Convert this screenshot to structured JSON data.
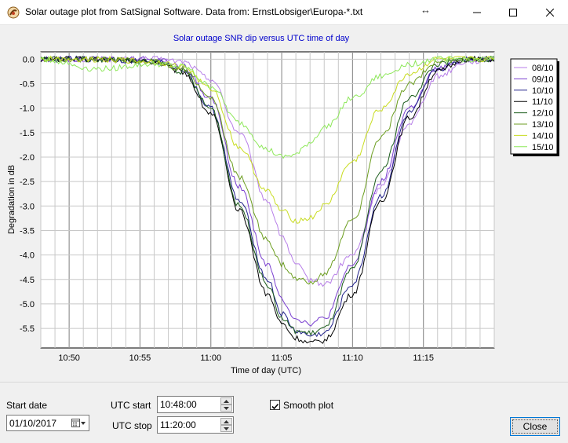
{
  "window": {
    "title": "Solar outage plot from SatSignal Software.  Data from: ErnstLobsiger\\Europa-*.txt",
    "resize_glyph": "↔"
  },
  "chart_data": {
    "type": "line",
    "title": "Solar outage SNR dip versus UTC time of day",
    "xlabel": "Time of day (UTC)",
    "ylabel": "Degradation in dB",
    "xlim": [
      "10:48:00",
      "11:20:00"
    ],
    "ylim": [
      -5.9,
      0.15
    ],
    "x_ticks": [
      "10:50",
      "10:55",
      "11:00",
      "11:05",
      "11:10",
      "11:15"
    ],
    "y_ticks": [
      "0.0",
      "-0.5",
      "-1.0",
      "-1.5",
      "-2.0",
      "-2.5",
      "-3.0",
      "-3.5",
      "-4.0",
      "-4.5",
      "-5.0",
      "-5.5"
    ],
    "grid": true,
    "legend_position": "top-right",
    "x": [
      "10:48:00",
      "10:52:00",
      "10:56:00",
      "10:58:00",
      "11:00:00",
      "11:02:00",
      "11:04:00",
      "11:05:00",
      "11:06:00",
      "11:07:00",
      "11:08:00",
      "11:10:00",
      "11:12:00",
      "11:14:00",
      "11:16:00",
      "11:18:00",
      "11:20:00"
    ],
    "series": [
      {
        "name": "08/10",
        "color": "#b77ee8",
        "values": [
          0.0,
          0.0,
          0.0,
          -0.05,
          -0.4,
          -1.5,
          -2.9,
          -3.6,
          -4.2,
          -4.5,
          -4.6,
          -4.0,
          -2.6,
          -1.3,
          -0.35,
          -0.05,
          0.0
        ]
      },
      {
        "name": "09/10",
        "color": "#7a3fd0",
        "values": [
          0.0,
          0.0,
          0.0,
          -0.15,
          -0.8,
          -2.6,
          -4.2,
          -4.9,
          -5.3,
          -5.4,
          -5.3,
          -4.2,
          -2.5,
          -1.0,
          -0.2,
          0.0,
          0.0
        ]
      },
      {
        "name": "10/10",
        "color": "#20208a",
        "values": [
          0.0,
          0.0,
          -0.05,
          -0.2,
          -1.0,
          -2.9,
          -4.5,
          -5.2,
          -5.55,
          -5.65,
          -5.6,
          -4.6,
          -2.8,
          -1.1,
          -0.2,
          0.0,
          0.0
        ]
      },
      {
        "name": "11/10",
        "color": "#000000",
        "values": [
          0.0,
          0.0,
          -0.05,
          -0.25,
          -1.1,
          -3.1,
          -4.8,
          -5.4,
          -5.7,
          -5.8,
          -5.75,
          -4.8,
          -2.9,
          -1.2,
          -0.25,
          0.0,
          0.0
        ]
      },
      {
        "name": "12/10",
        "color": "#1a5c1a",
        "values": [
          0.0,
          0.0,
          -0.05,
          -0.25,
          -1.0,
          -3.0,
          -4.6,
          -5.3,
          -5.55,
          -5.6,
          -5.5,
          -4.3,
          -2.3,
          -0.8,
          -0.1,
          0.0,
          0.0
        ]
      },
      {
        "name": "13/10",
        "color": "#6c9e20",
        "values": [
          0.0,
          0.0,
          -0.05,
          -0.2,
          -0.8,
          -2.4,
          -3.7,
          -4.2,
          -4.5,
          -4.55,
          -4.4,
          -3.3,
          -1.6,
          -0.5,
          -0.05,
          0.0,
          0.0
        ]
      },
      {
        "name": "14/10",
        "color": "#c8dc20",
        "values": [
          0.0,
          0.0,
          -0.05,
          -0.15,
          -0.6,
          -1.8,
          -2.7,
          -3.1,
          -3.3,
          -3.25,
          -3.0,
          -2.1,
          -1.0,
          -0.3,
          0.0,
          0.0,
          0.0
        ]
      },
      {
        "name": "15/10",
        "color": "#8ee85a",
        "values": [
          0.0,
          -0.2,
          -0.1,
          -0.15,
          -0.55,
          -1.3,
          -1.85,
          -2.0,
          -1.95,
          -1.7,
          -1.4,
          -0.8,
          -0.35,
          -0.1,
          0.0,
          0.0,
          0.0
        ]
      }
    ]
  },
  "controls": {
    "start_date_label": "Start date",
    "start_date_value": "01/10/2017",
    "utc_start_label": "UTC start",
    "utc_start_value": "10:48:00",
    "utc_stop_label": "UTC stop",
    "utc_stop_value": "11:20:00",
    "smooth_label": "Smooth plot",
    "smooth_checked": true,
    "close_label": "Close"
  },
  "colors": {
    "title_blue": "#0000cc",
    "grid": "#c8c8c8",
    "accent": "#0078d7"
  }
}
